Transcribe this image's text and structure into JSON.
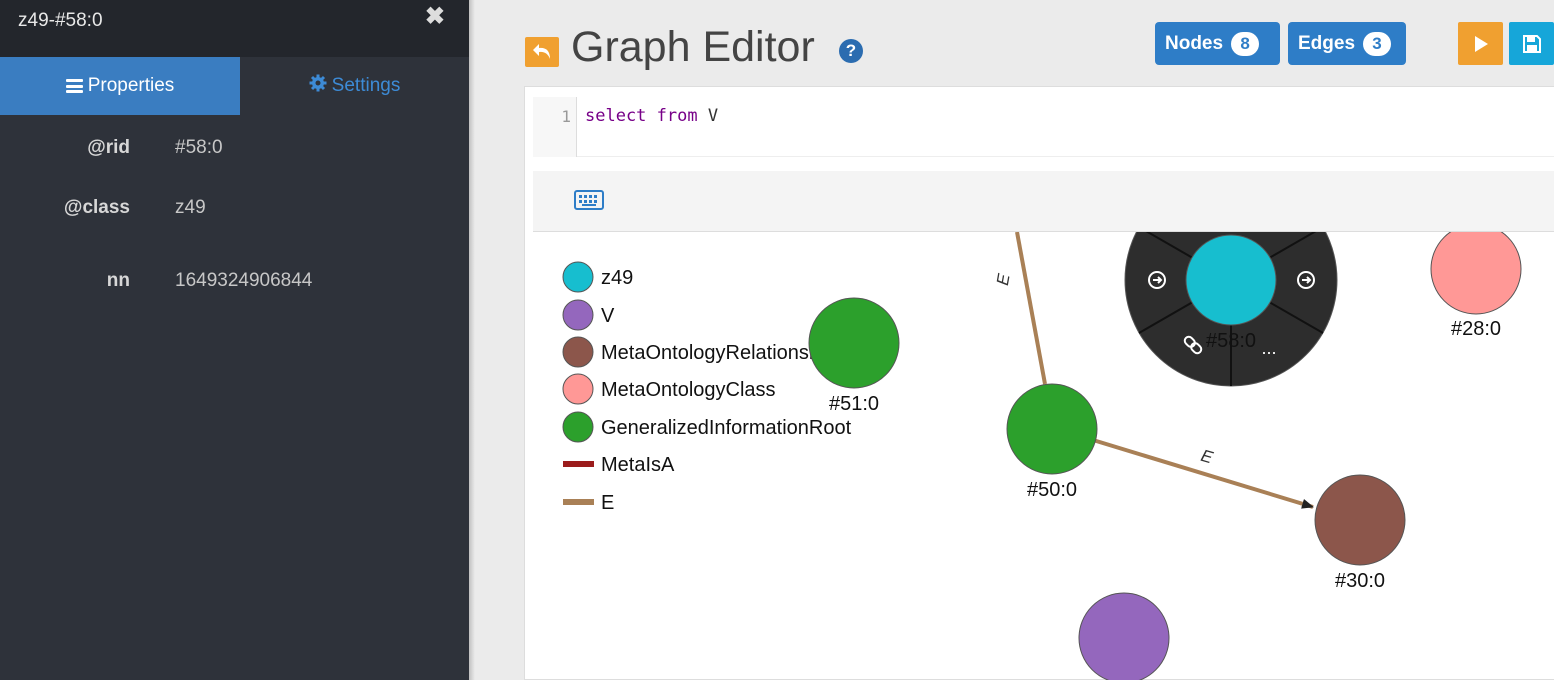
{
  "sidebar": {
    "title": "z49-#58:0",
    "close_label": "✖",
    "tabs": [
      {
        "label": "Properties",
        "icon": "bars-icon"
      },
      {
        "label": "Settings",
        "icon": "gear-icon"
      }
    ],
    "properties": [
      {
        "key": "@rid",
        "value": "#58:0"
      },
      {
        "key": "@class",
        "value": "z49"
      },
      {
        "key": "nn",
        "value": "1649324906844"
      }
    ]
  },
  "header": {
    "title": "Graph Editor",
    "help_label": "?",
    "nodes_label": "Nodes",
    "nodes_count": "8",
    "edges_label": "Edges",
    "edges_count": "3"
  },
  "editor": {
    "line_number": "1",
    "query_keyword_1": "select",
    "query_keyword_2": "from",
    "query_target": "V"
  },
  "graph": {
    "legend": [
      {
        "label": "z49",
        "color": "#17becf",
        "kind": "node"
      },
      {
        "label": "V",
        "color": "#9467bd",
        "kind": "node"
      },
      {
        "label": "MetaOntologyRelationship",
        "color": "#8c564b",
        "kind": "node"
      },
      {
        "label": "MetaOntologyClass",
        "color": "#ff9896",
        "kind": "node"
      },
      {
        "label": "GeneralizedInformationRoot",
        "color": "#2ca02c",
        "kind": "node"
      },
      {
        "label": "MetaIsA",
        "color": "#9b1c1c",
        "kind": "edge"
      },
      {
        "label": "E",
        "color": "#a98056",
        "kind": "edge"
      }
    ],
    "nodes": [
      {
        "label": "#58:0",
        "color": "#17becf",
        "selected": true
      },
      {
        "label": "#28:0",
        "color": "#ff9896"
      },
      {
        "label": "#51:0",
        "color": "#2ca02c"
      },
      {
        "label": "#50:0",
        "color": "#2ca02c"
      },
      {
        "label": "#30:0",
        "color": "#8c564b"
      },
      {
        "label": "",
        "color": "#9467bd"
      }
    ],
    "edge_label": "E",
    "ring_more_label": "..."
  }
}
